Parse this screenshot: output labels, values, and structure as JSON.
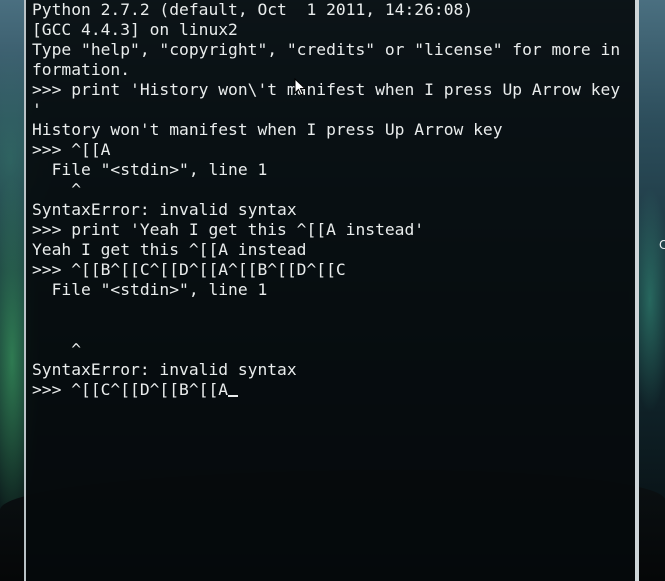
{
  "terminal": {
    "lines": [
      "Python 2.7.2 (default, Oct  1 2011, 14:26:08)",
      "[GCC 4.4.3] on linux2",
      "Type \"help\", \"copyright\", \"credits\" or \"license\" for more in",
      "formation.",
      ">>> print 'History won\\'t manifest when I press Up Arrow key",
      "'",
      "History won't manifest when I press Up Arrow key",
      ">>> ^[[A",
      "  File \"<stdin>\", line 1",
      "    ^",
      "SyntaxError: invalid syntax",
      ">>> print 'Yeah I get this ^[[A instead'",
      "Yeah I get this ^[[A instead",
      ">>> ^[[B^[[C^[[D^[[A^[[B^[[D^[[C",
      "  File \"<stdin>\", line 1",
      "",
      "",
      "    ^",
      "SyntaxError: invalid syntax"
    ],
    "prompt_line": ">>> ^[[C^[[D^[[B^[[A"
  },
  "desktop": {
    "edge_glyph": "C"
  }
}
